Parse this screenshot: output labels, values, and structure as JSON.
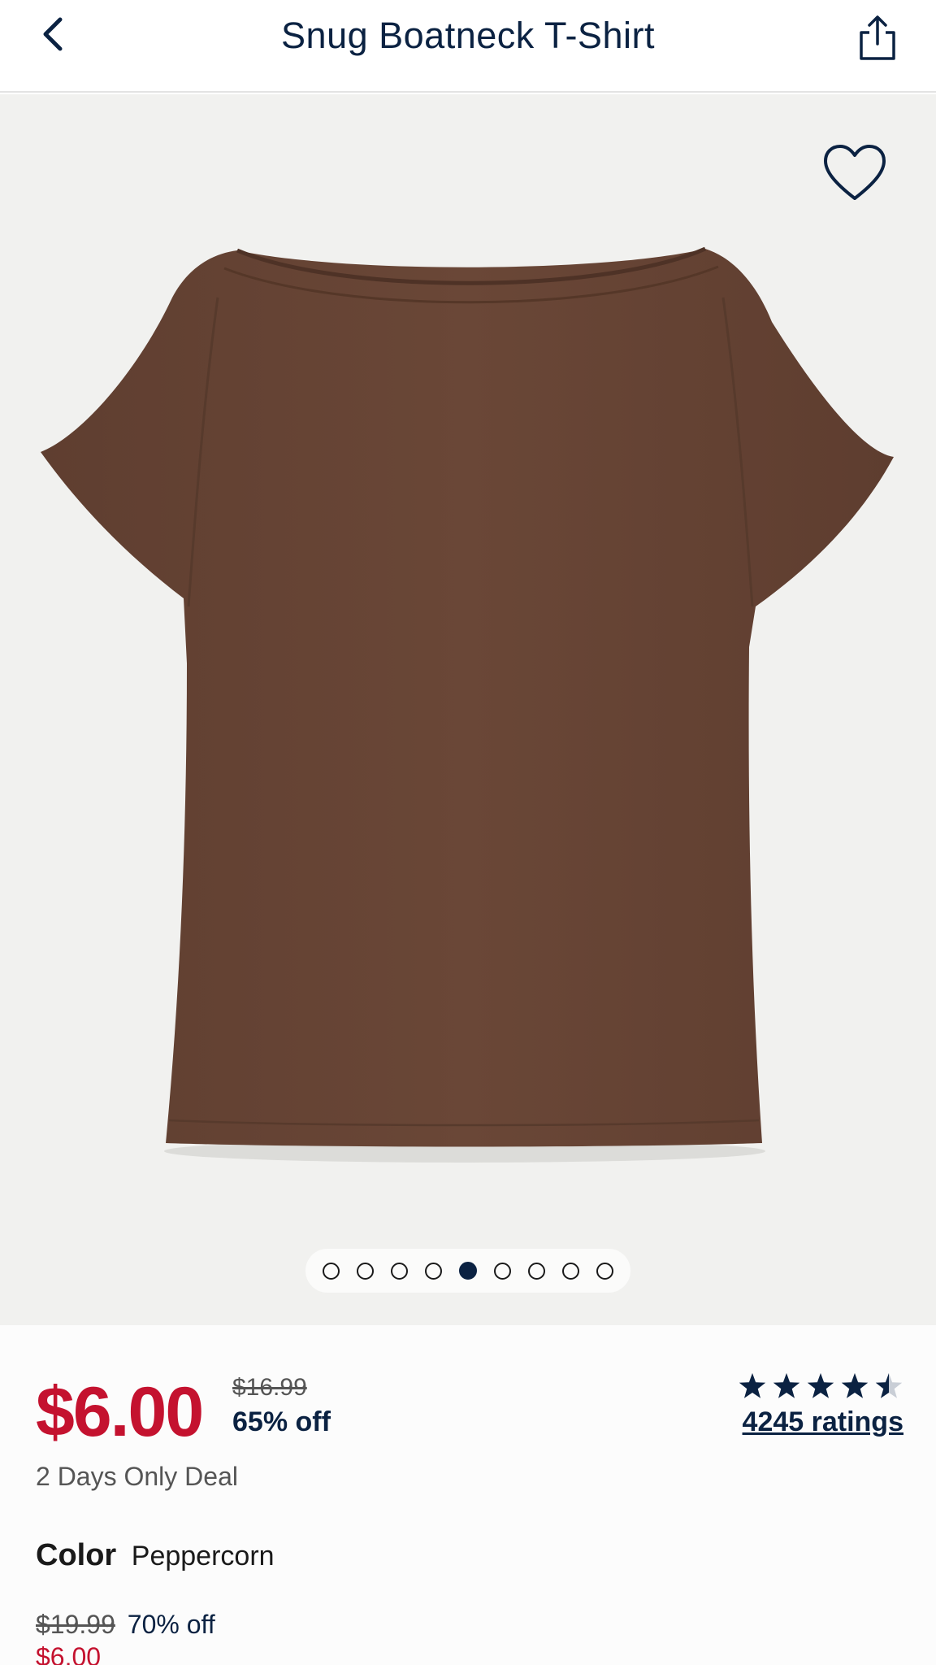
{
  "header": {
    "title": "Snug Boatneck T-Shirt",
    "back_icon": "chevron-left-icon",
    "share_icon": "share-icon"
  },
  "gallery": {
    "favorite_icon": "heart-icon",
    "image_description_icon": "product-image",
    "dot_count": 9,
    "active_index": 4
  },
  "pricing": {
    "sale_price": "$6.00",
    "original_price": "$16.99",
    "discount": "65% off",
    "deal": "2 Days Only Deal"
  },
  "rating": {
    "value": 4.5,
    "max": 5,
    "count_label": "4245 ratings"
  },
  "color": {
    "label": "Color",
    "value": "Peppercorn"
  },
  "swatch_pricing": {
    "original_price": "$19.99",
    "discount": "70% off",
    "sale_price": "$6.00"
  },
  "colors": {
    "navy": "#0b2242",
    "sale_red": "#c4122f",
    "shirt_brown": "#684536",
    "background": "#f1f1ef"
  }
}
